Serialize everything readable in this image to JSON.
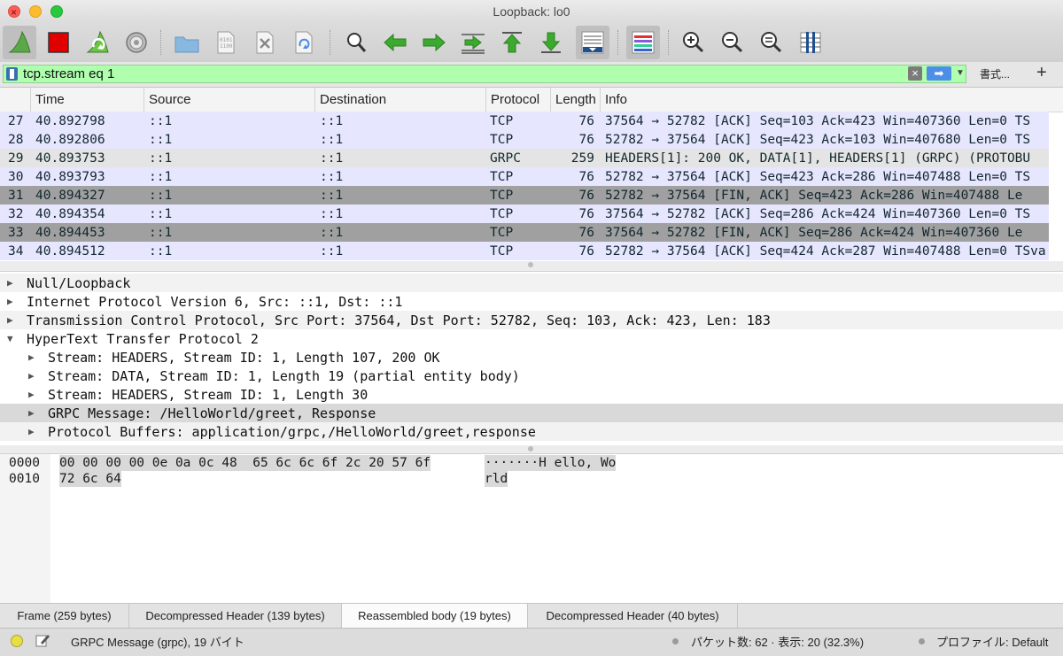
{
  "window": {
    "title": "Loopback: lo0"
  },
  "toolbar": {
    "buttons": [
      {
        "name": "start-capture-button",
        "icon": "shark-fin-icon"
      },
      {
        "name": "stop-capture-button",
        "icon": "stop-square-icon"
      },
      {
        "name": "restart-capture-button",
        "icon": "restart-fin-icon"
      },
      {
        "name": "capture-options-button",
        "icon": "gear-icon"
      },
      {
        "name": "open-file-button",
        "icon": "folder-icon"
      },
      {
        "name": "save-file-button",
        "icon": "file-binary-icon"
      },
      {
        "name": "close-file-button",
        "icon": "file-close-icon"
      },
      {
        "name": "reload-file-button",
        "icon": "reload-icon"
      },
      {
        "name": "find-packet-button",
        "icon": "magnifier-icon"
      },
      {
        "name": "go-back-button",
        "icon": "arrow-left-icon"
      },
      {
        "name": "go-forward-button",
        "icon": "arrow-right-icon"
      },
      {
        "name": "go-to-packet-button",
        "icon": "jump-icon"
      },
      {
        "name": "first-packet-button",
        "icon": "arrow-up-icon"
      },
      {
        "name": "last-packet-button",
        "icon": "arrow-down-icon"
      },
      {
        "name": "autoscroll-button",
        "icon": "autoscroll-icon"
      },
      {
        "name": "colorize-button",
        "icon": "colorize-icon"
      },
      {
        "name": "zoom-in-button",
        "icon": "zoom-in-icon"
      },
      {
        "name": "zoom-out-button",
        "icon": "zoom-out-icon"
      },
      {
        "name": "zoom-reset-button",
        "icon": "zoom-reset-icon"
      },
      {
        "name": "resize-columns-button",
        "icon": "resize-columns-icon"
      }
    ]
  },
  "filter": {
    "value": "tcp.stream eq 1",
    "expression_label": "書式...",
    "add_label": "+"
  },
  "packet_list": {
    "columns": [
      "Time",
      "Source",
      "Destination",
      "Protocol",
      "Length",
      "Info"
    ],
    "rows": [
      {
        "no": "27",
        "time": "40.892798",
        "src": "::1",
        "dst": "::1",
        "proto": "TCP",
        "len": "76",
        "info": "37564 → 52782 [ACK] Seq=103 Ack=423 Win=407360 Len=0 TS",
        "style": "tcp"
      },
      {
        "no": "28",
        "time": "40.892806",
        "src": "::1",
        "dst": "::1",
        "proto": "TCP",
        "len": "76",
        "info": "52782 → 37564 [ACK] Seq=423 Ack=103 Win=407680 Len=0 TS",
        "style": "tcp"
      },
      {
        "no": "29",
        "time": "40.893753",
        "src": "::1",
        "dst": "::1",
        "proto": "GRPC",
        "len": "259",
        "info": "HEADERS[1]: 200 OK, DATA[1], HEADERS[1] (GRPC) (PROTOBU",
        "style": "grpc"
      },
      {
        "no": "30",
        "time": "40.893793",
        "src": "::1",
        "dst": "::1",
        "proto": "TCP",
        "len": "76",
        "info": "52782 → 37564 [ACK] Seq=423 Ack=286 Win=407488 Len=0 TS",
        "style": "tcp"
      },
      {
        "no": "31",
        "time": "40.894327",
        "src": "::1",
        "dst": "::1",
        "proto": "TCP",
        "len": "76",
        "info": "52782 → 37564 [FIN, ACK] Seq=423 Ack=286 Win=407488 Le",
        "style": "fin"
      },
      {
        "no": "32",
        "time": "40.894354",
        "src": "::1",
        "dst": "::1",
        "proto": "TCP",
        "len": "76",
        "info": "37564 → 52782 [ACK] Seq=286 Ack=424 Win=407360 Len=0 TS",
        "style": "tcp"
      },
      {
        "no": "33",
        "time": "40.894453",
        "src": "::1",
        "dst": "::1",
        "proto": "TCP",
        "len": "76",
        "info": "37564 → 52782 [FIN, ACK] Seq=286 Ack=424 Win=407360 Le",
        "style": "fin"
      },
      {
        "no": "34",
        "time": "40.894512",
        "src": "::1",
        "dst": "::1",
        "proto": "TCP",
        "len": "76",
        "info": "52782 → 37564 [ACK] Seq=424 Ack=287 Win=407488 Len=0 TSva",
        "style": "tcp"
      }
    ]
  },
  "details": {
    "rows": [
      {
        "text": "Null/Loopback",
        "level": 0,
        "expanded": false,
        "style": "alt"
      },
      {
        "text": "Internet Protocol Version 6, Src: ::1, Dst: ::1",
        "level": 0,
        "expanded": false,
        "style": ""
      },
      {
        "text": "Transmission Control Protocol, Src Port: 37564, Dst Port: 52782, Seq: 103, Ack: 423, Len: 183",
        "level": 0,
        "expanded": false,
        "style": "alt"
      },
      {
        "text": "HyperText Transfer Protocol 2",
        "level": 0,
        "expanded": true,
        "style": ""
      },
      {
        "text": "Stream: HEADERS, Stream ID: 1, Length 107, 200 OK",
        "level": 1,
        "expanded": false,
        "style": ""
      },
      {
        "text": "Stream: DATA, Stream ID: 1, Length 19 (partial entity body)",
        "level": 1,
        "expanded": false,
        "style": ""
      },
      {
        "text": "Stream: HEADERS, Stream ID: 1, Length 30",
        "level": 1,
        "expanded": false,
        "style": ""
      },
      {
        "text": "GRPC Message: /HelloWorld/greet, Response",
        "level": 1,
        "expanded": false,
        "style": "sel"
      },
      {
        "text": "Protocol Buffers: application/grpc,/HelloWorld/greet,response",
        "level": 1,
        "expanded": false,
        "style": "alt"
      }
    ]
  },
  "bytes": {
    "rows": [
      {
        "offset": "0000",
        "hex": "00 00 00 00 0e 0a 0c 48  65 6c 6c 6f 2c 20 57 6f",
        "ascii": "·······H ello, Wo"
      },
      {
        "offset": "0010",
        "hex": "72 6c 64",
        "ascii": "rld"
      }
    ]
  },
  "tabs": {
    "items": [
      {
        "label": "Frame (259 bytes)",
        "active": false
      },
      {
        "label": "Decompressed Header (139 bytes)",
        "active": false
      },
      {
        "label": "Reassembled body (19 bytes)",
        "active": true
      },
      {
        "label": "Decompressed Header (40 bytes)",
        "active": false
      }
    ]
  },
  "status": {
    "message": "GRPC Message (grpc), 19 バイト",
    "packets": "パケット数: 62 · 表示: 20 (32.3%)",
    "profile": "プロファイル: Default"
  },
  "colors": {
    "filter_valid": "#afffaf",
    "row_tcp": "#e7e6ff",
    "row_grpc": "#e4e4e4",
    "row_fin": "#a0a0a0",
    "fin_fill": "#6cc644",
    "stop_fill": "#e00000",
    "arrow_fill": "#3caa2e"
  }
}
